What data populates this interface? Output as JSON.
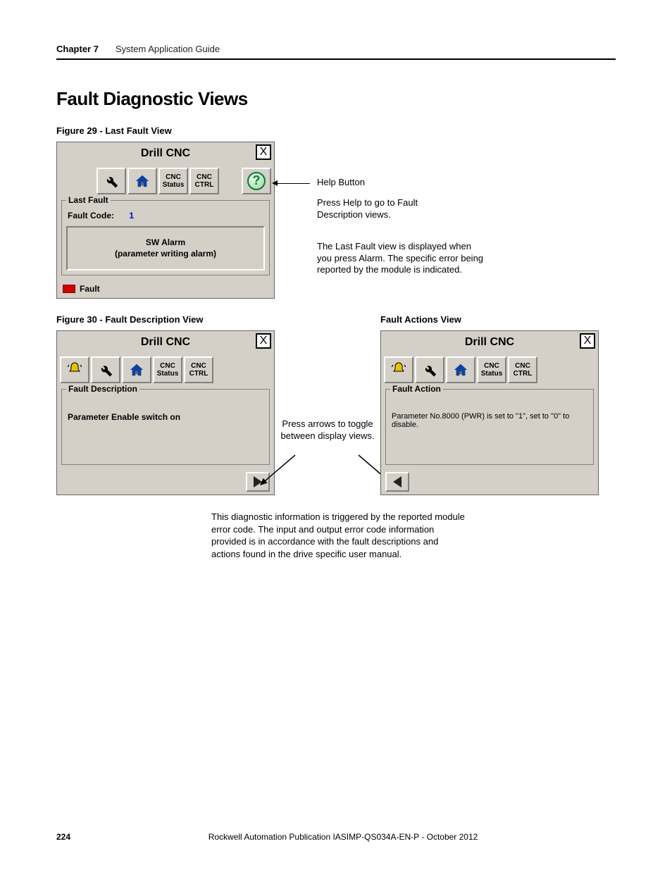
{
  "header": {
    "chapter": "Chapter 7",
    "title": "System Application Guide"
  },
  "section_title": "Fault Diagnostic Views",
  "fig29": {
    "caption": "Figure 29 - Last Fault View",
    "dialog": {
      "title": "Drill CNC",
      "close": "X",
      "toolbar": {
        "status": "CNC\nStatus",
        "ctrl": "CNC\nCTRL"
      },
      "group_legend": "Last Fault",
      "fault_code_label": "Fault Code:",
      "fault_code_value": "1",
      "alarm_line1": "SW Alarm",
      "alarm_line2": "(parameter writing alarm)",
      "footer_label": "Fault"
    },
    "annot_help_label": "Help Button",
    "annot_help_text": "Press Help to go to Fault Description views.",
    "annot_body": "The Last Fault view is displayed when you press Alarm. The specific error being reported by the module is indicated."
  },
  "fig30": {
    "caption_left": "Figure 30 - Fault Description View",
    "caption_right": "Fault Actions View",
    "left": {
      "title": "Drill CNC",
      "close": "X",
      "toolbar": {
        "status": "CNC\nStatus",
        "ctrl": "CNC\nCTRL"
      },
      "group_legend": "Fault Description",
      "body_text": "Parameter Enable switch on"
    },
    "right": {
      "title": "Drill CNC",
      "close": "X",
      "toolbar": {
        "status": "CNC\nStatus",
        "ctrl": "CNC\nCTRL"
      },
      "group_legend": "Fault Action",
      "body_text": "Parameter No.8000 (PWR) is set to \"1\", set to \"0\" to disable."
    },
    "mid_annot": "Press arrows to toggle between display views."
  },
  "bottom_para": "This diagnostic information is triggered by the reported module error code. The input and output error code information provided is in accordance with the fault descriptions and actions found in the drive specific user manual.",
  "footer": {
    "page_number": "224",
    "publication": "Rockwell Automation Publication IASIMP-QS034A-EN-P - ",
    "date": "October 2012"
  }
}
